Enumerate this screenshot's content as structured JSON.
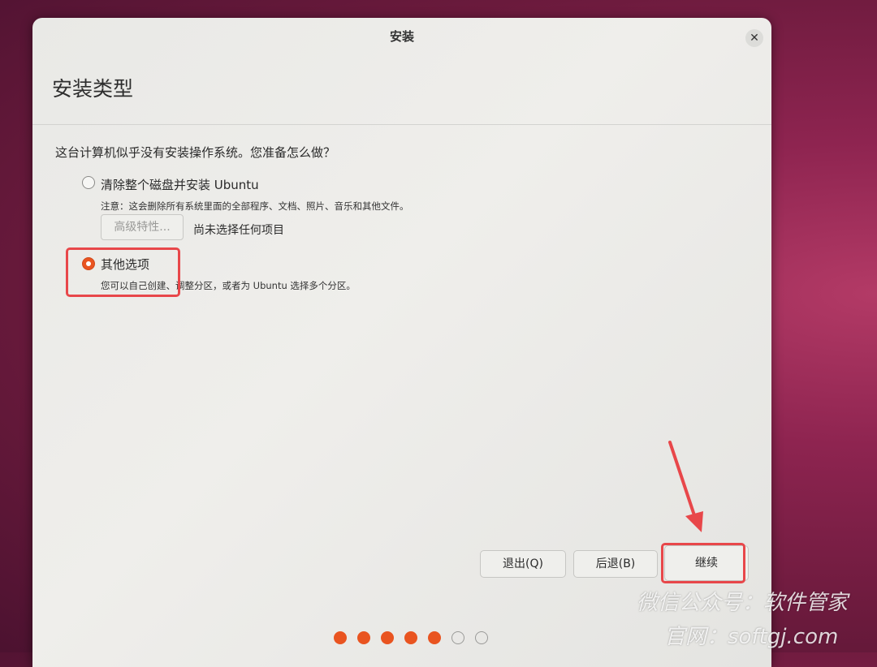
{
  "window": {
    "title": "安装"
  },
  "page": {
    "heading": "安装类型",
    "question": "这台计算机似乎没有安装操作系统。您准备怎么做？"
  },
  "options": [
    {
      "label": "清除整个磁盘并安装 Ubuntu",
      "checked": false,
      "note_prefix": "注意：",
      "note": "这会删除所有系统里面的全部程序、文档、照片、音乐和其他文件。"
    },
    {
      "label": "其他选项",
      "checked": true,
      "note": "您可以自己创建、调整分区，或者为 Ubuntu 选择多个分区。"
    }
  ],
  "advanced": {
    "button_label": "高级特性...",
    "status": "尚未选择任何项目"
  },
  "buttons": {
    "quit": "退出(Q)",
    "back": "后退(B)",
    "continue": "继续"
  },
  "progress": {
    "total_steps": 7,
    "completed_steps": 5
  },
  "watermark": {
    "line1": "微信公众号：软件管家",
    "line2": "官网：softgj.com"
  },
  "colors": {
    "accent": "#e95420",
    "annotation": "#e8474a"
  },
  "icons": {
    "close": "close-icon",
    "arrow": "red-arrow-annotation"
  }
}
